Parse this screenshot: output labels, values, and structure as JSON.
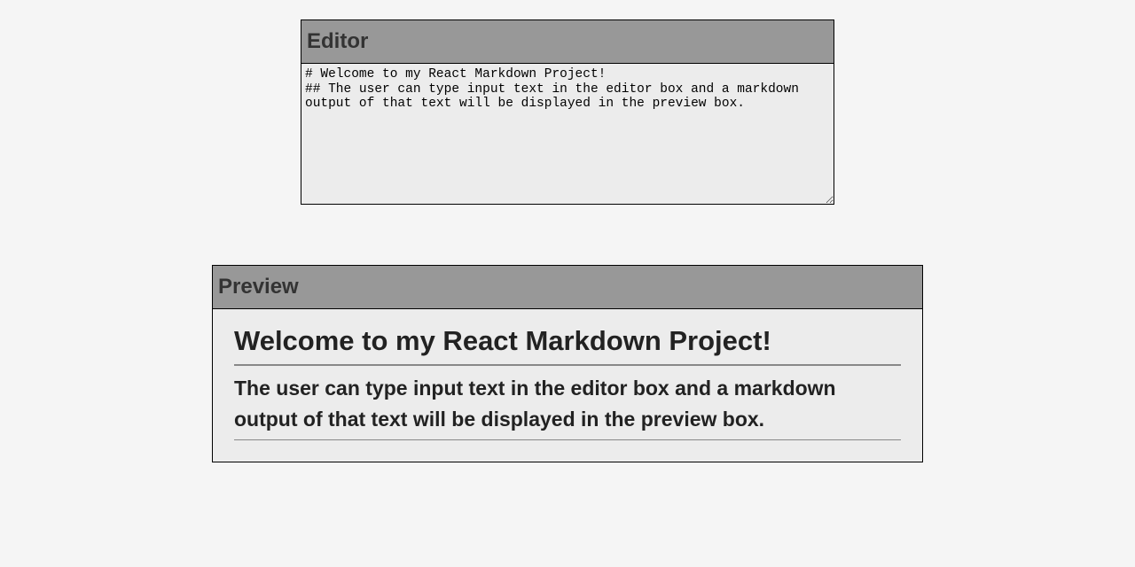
{
  "editor": {
    "header": "Editor",
    "content": "# Welcome to my React Markdown Project!\n## The user can type input text in the editor box and a markdown output of that text will be displayed in the preview box."
  },
  "preview": {
    "header": "Preview",
    "h1": "Welcome to my React Markdown Project!",
    "h2": "The user can type input text in the editor box and a markdown output of that text will be displayed in the preview box."
  }
}
